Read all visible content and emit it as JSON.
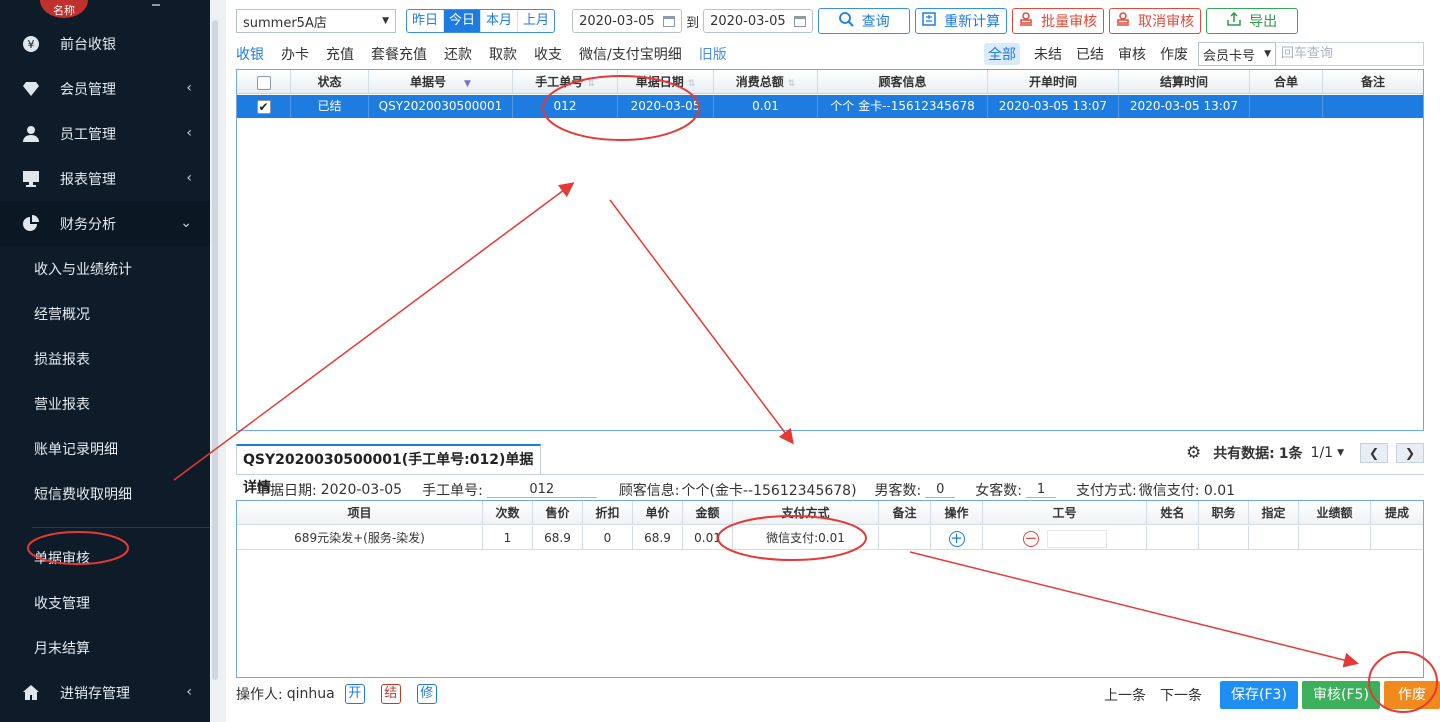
{
  "sidebar": {
    "logo_text": "名称",
    "items": [
      {
        "label": "前台收银",
        "icon": "yen-icon"
      },
      {
        "label": "会员管理",
        "icon": "diamond-icon",
        "chevron": "‹"
      },
      {
        "label": "员工管理",
        "icon": "user-icon",
        "chevron": "‹"
      },
      {
        "label": "报表管理",
        "icon": "monitor-icon",
        "chevron": "‹"
      },
      {
        "label": "财务分析",
        "icon": "pie-chart-icon",
        "chevron": "⌄"
      }
    ],
    "sub_items": [
      "收入与业绩统计",
      "经营概况",
      "损益报表",
      "营业报表",
      "账单记录明细",
      "短信费收取明细",
      "单据审核",
      "收支管理",
      "月末结算"
    ],
    "bottom_item": {
      "label": "进销存管理",
      "icon": "home-icon",
      "chevron": "‹"
    }
  },
  "toolbar": {
    "store": "summer5A店",
    "periods": [
      "昨日",
      "今日",
      "本月",
      "上月"
    ],
    "active_period": "今日",
    "date_from": "2020-03-05",
    "to_label": "到",
    "date_to": "2020-03-05",
    "query": "查询",
    "recalc": "重新计算",
    "batch_audit": "批量审核",
    "cancel_audit": "取消审核",
    "export": "导出"
  },
  "tabs": [
    "收银",
    "办卡",
    "充值",
    "套餐充值",
    "还款",
    "取款",
    "收支",
    "微信/支付宝明细",
    "旧版"
  ],
  "filters": {
    "options": [
      "全部",
      "未结",
      "已结",
      "审核",
      "作废"
    ],
    "search_type": "会员卡号",
    "search_placeholder": "回车查询"
  },
  "grid": {
    "columns": [
      "状态",
      "单据号",
      "手工单号",
      "单据日期",
      "消费总额",
      "顾客信息",
      "开单时间",
      "结算时间",
      "合单",
      "备注"
    ],
    "rows": [
      {
        "checked": "✔",
        "status": "已结",
        "bill_no": "QSY2020030500001",
        "manual_no": "012",
        "date": "2020-03-05",
        "total": "0.01",
        "customer": "个个 金卡--15612345678",
        "open_time": "2020-03-05 13:07",
        "settle_time": "2020-03-05 13:07",
        "merge": "",
        "note": ""
      }
    ]
  },
  "detail": {
    "tab_title": "QSY2020030500001(手工单号:012)单据详情",
    "total_label": "共有数据:",
    "total_value": "1条",
    "page": "1/1",
    "info": {
      "date_label": "单据日期:",
      "date_value": "2020-03-05",
      "manual_label": "手工单号:",
      "manual_value": "012",
      "customer_label": "顾客信息:",
      "customer_value": "个个(金卡--15612345678)",
      "male_label": "男客数:",
      "male_value": "0",
      "female_label": "女客数:",
      "female_value": "1",
      "pay_label": "支付方式:",
      "pay_value": "微信支付: 0.01"
    },
    "columns": [
      "项目",
      "次数",
      "售价",
      "折扣",
      "单价",
      "金额",
      "支付方式",
      "备注",
      "操作",
      "工号",
      "姓名",
      "职务",
      "指定",
      "业绩额",
      "提成"
    ],
    "rows": [
      {
        "item": "689元染发+(服务-染发)",
        "times": "1",
        "price": "68.9",
        "discount": "0",
        "unit": "68.9",
        "amount": "0.01",
        "pay": "微信支付:0.01",
        "note": ""
      }
    ]
  },
  "footer": {
    "operator_label": "操作人:",
    "operator": "qinhua",
    "mini_buttons": [
      "开",
      "结",
      "修"
    ],
    "prev": "上一条",
    "next": "下一条",
    "save": "保存(F3)",
    "audit": "审核(F5)",
    "void": "作废"
  },
  "colors": {
    "sidebar": "#0e1c2a",
    "primary": "#1e7be0",
    "danger": "#e5493a",
    "success": "#3cb05a",
    "warning": "#f08a1c",
    "annotation": "#e53935"
  }
}
